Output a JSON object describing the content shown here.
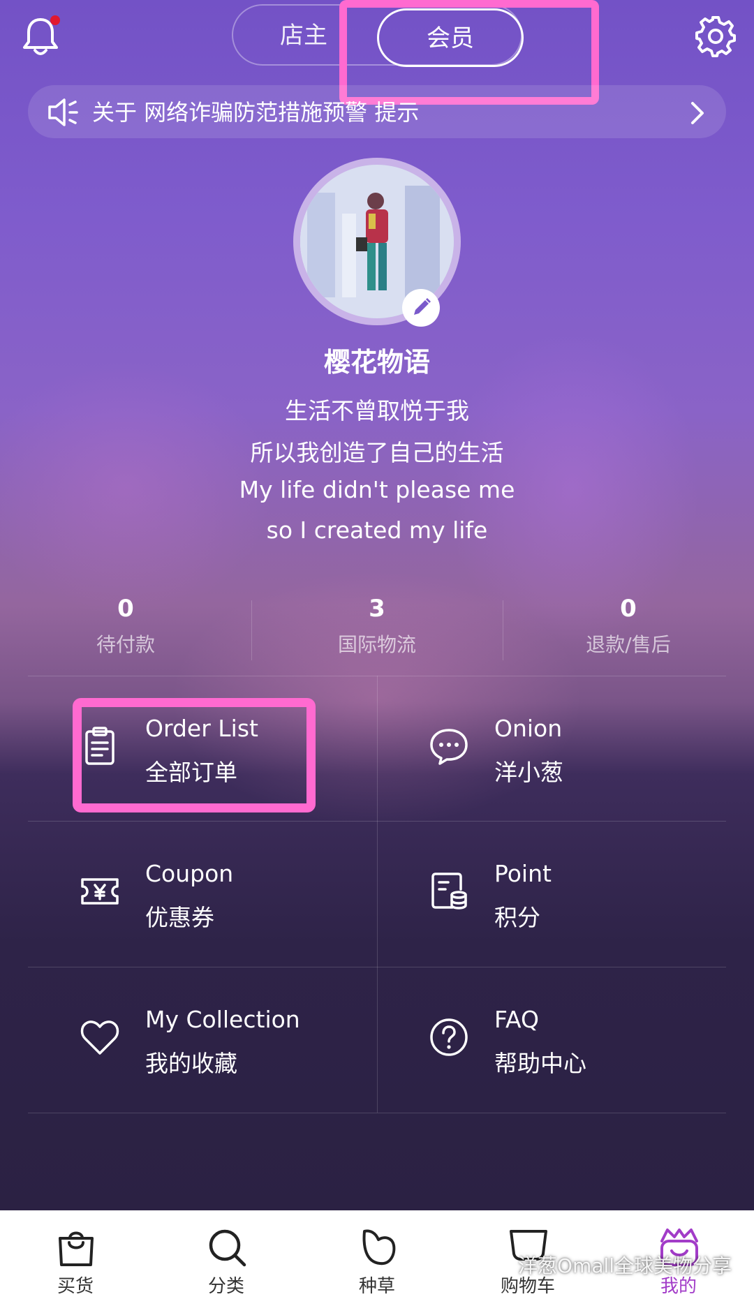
{
  "header": {
    "tabs": [
      {
        "label": "店主",
        "active": false
      },
      {
        "label": "会员",
        "active": true
      }
    ],
    "notification_badge": true
  },
  "notice": {
    "text": "关于 网络诈骗防范措施预警 提示"
  },
  "profile": {
    "name": "樱花物语",
    "bio": [
      "生活不曾取悦于我",
      "所以我创造了自己的生活",
      "My life didn't please me",
      "so I created my life"
    ]
  },
  "stats": [
    {
      "value": "0",
      "label": "待付款"
    },
    {
      "value": "3",
      "label": "国际物流"
    },
    {
      "value": "0",
      "label": "退款/售后"
    }
  ],
  "menu": [
    {
      "en": "Order List",
      "zh": "全部订单",
      "icon": "clipboard-icon"
    },
    {
      "en": "Onion",
      "zh": "洋小葱",
      "icon": "chat-bubble-icon"
    },
    {
      "en": "Coupon",
      "zh": "优惠券",
      "icon": "coupon-icon"
    },
    {
      "en": "Point",
      "zh": "积分",
      "icon": "points-icon"
    },
    {
      "en": "My Collection",
      "zh": "我的收藏",
      "icon": "heart-icon"
    },
    {
      "en": "FAQ",
      "zh": "帮助中心",
      "icon": "help-icon"
    }
  ],
  "tabbar": [
    {
      "label": "买货",
      "icon": "shopping-bag-icon",
      "active": false
    },
    {
      "label": "分类",
      "icon": "search-icon",
      "active": false
    },
    {
      "label": "种草",
      "icon": "leaf-icon",
      "active": false
    },
    {
      "label": "购物车",
      "icon": "cart-icon",
      "active": false
    },
    {
      "label": "我的",
      "icon": "profile-crown-icon",
      "active": true
    }
  ],
  "watermark": "洋葱Omall全球美物分享",
  "colors": {
    "highlight": "#ff6ad0",
    "active_tab": "#a23cc8",
    "badge": "#e1182f"
  }
}
